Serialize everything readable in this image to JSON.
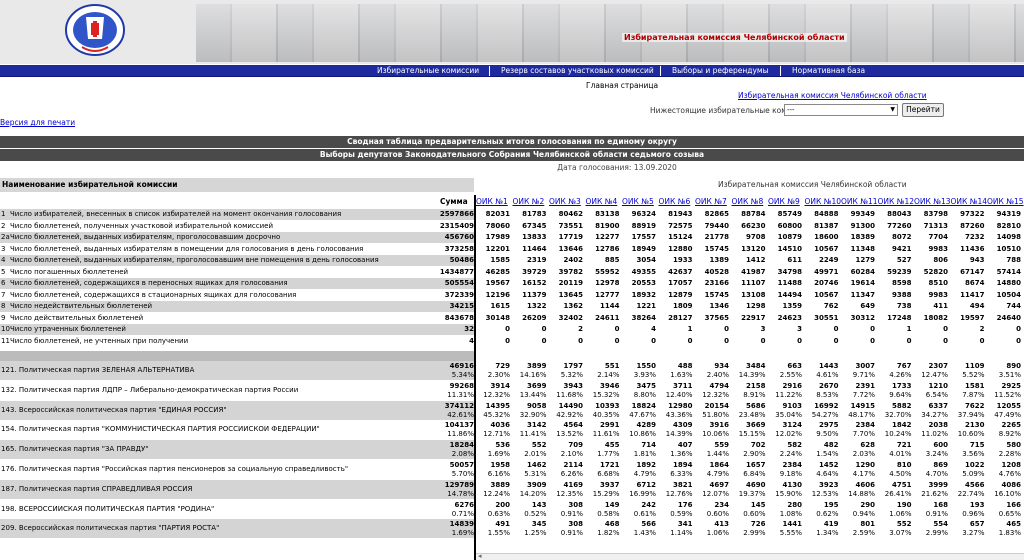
{
  "banner": {
    "title": "Избирательная комиссия Челябинской области"
  },
  "nav": [
    {
      "label": "Избирательные комиссии"
    },
    {
      "label": "Резерв составов участковых комиссий"
    },
    {
      "label": "Выборы и референдумы"
    },
    {
      "label": "Нормативная база"
    }
  ],
  "home_link": "Главная страница",
  "parent_link": "Избирательная комиссия Челябинской области",
  "subcommission": {
    "label": "Нижестоящие избирательные комиссии:",
    "selected": "---",
    "button": "Перейти"
  },
  "print_link": "Версия для печати",
  "report_title": "Сводная таблица предварительных итогов голосования по единому округу",
  "election_title": "Выборы депутатов Законодательного Собрания Челябинской области седьмого созыва",
  "date_line": "Дата голосования: 13.09.2020",
  "left_header": "Наименование избирательной комиссии",
  "right_header": "Избирательная комиссия Челябинской области",
  "sum_header": "Сумма",
  "columns": [
    "ОИК №1",
    "ОИК №2",
    "ОИК №3",
    "ОИК №4",
    "ОИК №5",
    "ОИК №6",
    "ОИК №7",
    "ОИК №8",
    "ОИК №9",
    "ОИК №10",
    "ОИК №11",
    "ОИК №12",
    "ОИК №13",
    "ОИК №14",
    "ОИК №15"
  ],
  "rows": [
    {
      "n": "1",
      "name": "Число избирателей, внесенных в список избирателей на момент окончания голосования",
      "total": "2597866",
      "v": [
        "82031",
        "81783",
        "80462",
        "83138",
        "96324",
        "81943",
        "82865",
        "88784",
        "85749",
        "84888",
        "99349",
        "88043",
        "83798",
        "97322",
        "94319"
      ]
    },
    {
      "n": "2",
      "name": "Число бюллетеней, полученных участковой избирательной комиссией",
      "total": "2315409",
      "v": [
        "78060",
        "67345",
        "73551",
        "81900",
        "88919",
        "72575",
        "79440",
        "66230",
        "60800",
        "81387",
        "91300",
        "77260",
        "71313",
        "87260",
        "82810"
      ]
    },
    {
      "n": "2а",
      "name": "Число бюллетеней, выданных избирателям, проголосовавшим досрочно",
      "total": "456760",
      "v": [
        "17989",
        "13833",
        "17719",
        "12277",
        "17557",
        "15124",
        "21778",
        "9708",
        "10879",
        "18600",
        "18389",
        "8072",
        "7704",
        "7232",
        "14098"
      ]
    },
    {
      "n": "3",
      "name": "Число бюллетеней, выданных избирателям в помещении для голосования в день голосования",
      "total": "373258",
      "v": [
        "12201",
        "11464",
        "13646",
        "12786",
        "18949",
        "12880",
        "15745",
        "13120",
        "14510",
        "10567",
        "11348",
        "9421",
        "9983",
        "11436",
        "10510"
      ]
    },
    {
      "n": "4",
      "name": "Число бюллетеней, выданных избирателям, проголосовавшим вне помещения в день голосования",
      "total": "50486",
      "v": [
        "1585",
        "2319",
        "2402",
        "885",
        "3054",
        "1933",
        "1389",
        "1412",
        "611",
        "2249",
        "1279",
        "527",
        "806",
        "943",
        "788"
      ]
    },
    {
      "n": "5",
      "name": "Число погашенных бюллетеней",
      "total": "1434877",
      "v": [
        "46285",
        "39729",
        "39782",
        "55952",
        "49355",
        "42637",
        "40528",
        "41987",
        "34798",
        "49971",
        "60284",
        "59239",
        "52820",
        "67147",
        "57414"
      ]
    },
    {
      "n": "6",
      "name": "Число бюллетеней, содержащихся в переносных ящиках для голосования",
      "total": "505554",
      "v": [
        "19567",
        "16152",
        "20119",
        "12978",
        "20553",
        "17057",
        "23166",
        "11107",
        "11488",
        "20746",
        "19614",
        "8598",
        "8510",
        "8674",
        "14880"
      ]
    },
    {
      "n": "7",
      "name": "Число бюллетеней, содержащихся в стационарных ящиках для голосования",
      "total": "372339",
      "v": [
        "12196",
        "11379",
        "13645",
        "12777",
        "18932",
        "12879",
        "15745",
        "13108",
        "14494",
        "10567",
        "11347",
        "9388",
        "9983",
        "11417",
        "10504"
      ]
    },
    {
      "n": "8",
      "name": "Число недействительных бюллетеней",
      "total": "34215",
      "v": [
        "1615",
        "1322",
        "1362",
        "1144",
        "1221",
        "1809",
        "1346",
        "1298",
        "1359",
        "762",
        "649",
        "738",
        "411",
        "494",
        "744"
      ]
    },
    {
      "n": "9",
      "name": "Число действительных бюллетеней",
      "total": "843678",
      "v": [
        "30148",
        "26209",
        "32402",
        "24611",
        "38264",
        "28127",
        "37565",
        "22917",
        "24623",
        "30551",
        "30312",
        "17248",
        "18082",
        "19597",
        "24640"
      ]
    },
    {
      "n": "10",
      "name": "Число утраченных бюллетеней",
      "total": "32",
      "v": [
        "0",
        "0",
        "2",
        "0",
        "4",
        "1",
        "0",
        "3",
        "3",
        "0",
        "0",
        "1",
        "0",
        "2",
        "0"
      ]
    },
    {
      "n": "11",
      "name": "Число бюллетеней, не учтенных при получении",
      "total": "4",
      "v": [
        "0",
        "0",
        "0",
        "0",
        "0",
        "0",
        "0",
        "0",
        "0",
        "0",
        "0",
        "0",
        "0",
        "0",
        "0"
      ]
    }
  ],
  "parties": [
    {
      "n": "12",
      "name": "1. Политическая партия ЗЕЛЕНАЯ АЛЬТЕРНАТИВА",
      "total": "46916",
      "pct": "5.34%",
      "v": [
        "729",
        "3899",
        "1797",
        "551",
        "1550",
        "488",
        "934",
        "3484",
        "663",
        "1443",
        "3007",
        "767",
        "2307",
        "1109",
        "890"
      ],
      "p": [
        "2.30%",
        "14.16%",
        "5.32%",
        "2.14%",
        "3.93%",
        "1.63%",
        "2.40%",
        "14.39%",
        "2.55%",
        "4.61%",
        "9.71%",
        "4.26%",
        "12.47%",
        "5.52%",
        "3.51%"
      ]
    },
    {
      "n": "13",
      "name": "2. Политическая партия ЛДПР – Либерально-демократическая партия России",
      "total": "99268",
      "pct": "11.31%",
      "v": [
        "3914",
        "3699",
        "3943",
        "3946",
        "3475",
        "3711",
        "4794",
        "2158",
        "2916",
        "2670",
        "2391",
        "1733",
        "1210",
        "1581",
        "2925"
      ],
      "p": [
        "12.32%",
        "13.44%",
        "11.68%",
        "15.32%",
        "8.80%",
        "12.40%",
        "12.32%",
        "8.91%",
        "11.22%",
        "8.53%",
        "7.72%",
        "9.64%",
        "6.54%",
        "7.87%",
        "11.52%"
      ]
    },
    {
      "n": "14",
      "name": "3. Всероссийская политическая партия \"ЕДИНАЯ РОССИЯ\"",
      "total": "374112",
      "pct": "42.61%",
      "v": [
        "14395",
        "9058",
        "14490",
        "10393",
        "18824",
        "12980",
        "20154",
        "5686",
        "9103",
        "16992",
        "14915",
        "5882",
        "6337",
        "7622",
        "12055"
      ],
      "p": [
        "45.32%",
        "32.90%",
        "42.92%",
        "40.35%",
        "47.67%",
        "43.36%",
        "51.80%",
        "23.48%",
        "35.04%",
        "54.27%",
        "48.17%",
        "32.70%",
        "34.27%",
        "37.94%",
        "47.49%"
      ]
    },
    {
      "n": "15",
      "name": "4. Политическая партия \"КОММУНИСТИЧЕСКАЯ ПАРТИЯ РОССИЙСКОЙ ФЕДЕРАЦИИ\"",
      "total": "104137",
      "pct": "11.86%",
      "v": [
        "4036",
        "3142",
        "4564",
        "2991",
        "4289",
        "4309",
        "3916",
        "3669",
        "3124",
        "2975",
        "2384",
        "1842",
        "2038",
        "2130",
        "2265"
      ],
      "p": [
        "12.71%",
        "11.41%",
        "13.52%",
        "11.61%",
        "10.86%",
        "14.39%",
        "10.06%",
        "15.15%",
        "12.02%",
        "9.50%",
        "7.70%",
        "10.24%",
        "11.02%",
        "10.60%",
        "8.92%"
      ]
    },
    {
      "n": "16",
      "name": "5. Политическая партия \"ЗА ПРАВДУ\"",
      "total": "18284",
      "pct": "2.08%",
      "v": [
        "536",
        "552",
        "709",
        "455",
        "714",
        "407",
        "559",
        "702",
        "582",
        "482",
        "628",
        "721",
        "600",
        "715",
        "580"
      ],
      "p": [
        "1.69%",
        "2.01%",
        "2.10%",
        "1.77%",
        "1.81%",
        "1.36%",
        "1.44%",
        "2.90%",
        "2.24%",
        "1.54%",
        "2.03%",
        "4.01%",
        "3.24%",
        "3.56%",
        "2.28%"
      ]
    },
    {
      "n": "17",
      "name": "6. Политическая партия \"Российская партия пенсионеров за социальную справедливость\"",
      "total": "50057",
      "pct": "5.70%",
      "v": [
        "1958",
        "1462",
        "2114",
        "1721",
        "1892",
        "1894",
        "1864",
        "1657",
        "2384",
        "1452",
        "1290",
        "810",
        "869",
        "1022",
        "1208"
      ],
      "p": [
        "6.16%",
        "5.31%",
        "6.26%",
        "6.68%",
        "4.79%",
        "6.33%",
        "4.79%",
        "6.84%",
        "9.18%",
        "4.64%",
        "4.17%",
        "4.50%",
        "4.70%",
        "5.09%",
        "4.76%"
      ]
    },
    {
      "n": "18",
      "name": "7. Политическая партия СПРАВЕДЛИВАЯ РОССИЯ",
      "total": "129789",
      "pct": "14.78%",
      "v": [
        "3889",
        "3909",
        "4169",
        "3937",
        "6712",
        "3821",
        "4697",
        "4690",
        "4130",
        "3923",
        "4606",
        "4751",
        "3999",
        "4566",
        "4086"
      ],
      "p": [
        "12.24%",
        "14.20%",
        "12.35%",
        "15.29%",
        "16.99%",
        "12.76%",
        "12.07%",
        "19.37%",
        "15.90%",
        "12.53%",
        "14.88%",
        "26.41%",
        "21.62%",
        "22.74%",
        "16.10%"
      ]
    },
    {
      "n": "19",
      "name": "8. ВСЕРОССИЙСКАЯ ПОЛИТИЧЕСКАЯ ПАРТИЯ \"РОДИНА\"",
      "total": "6276",
      "pct": "0.71%",
      "v": [
        "200",
        "143",
        "308",
        "149",
        "242",
        "176",
        "234",
        "145",
        "280",
        "195",
        "290",
        "190",
        "168",
        "193",
        "166"
      ],
      "p": [
        "0.63%",
        "0.52%",
        "0.91%",
        "0.58%",
        "0.61%",
        "0.59%",
        "0.60%",
        "0.60%",
        "1.08%",
        "0.62%",
        "0.94%",
        "1.06%",
        "0.91%",
        "0.96%",
        "0.65%"
      ]
    },
    {
      "n": "20",
      "name": "9. Всероссийская политическая партия \"ПАРТИЯ РОСТА\"",
      "total": "14839",
      "pct": "1.69%",
      "v": [
        "491",
        "345",
        "308",
        "468",
        "566",
        "341",
        "413",
        "726",
        "1441",
        "419",
        "801",
        "552",
        "554",
        "657",
        "465"
      ],
      "p": [
        "1.55%",
        "1.25%",
        "0.91%",
        "1.82%",
        "1.43%",
        "1.14%",
        "1.06%",
        "2.99%",
        "5.55%",
        "1.34%",
        "2.59%",
        "3.07%",
        "2.99%",
        "3.27%",
        "1.83%"
      ]
    }
  ]
}
